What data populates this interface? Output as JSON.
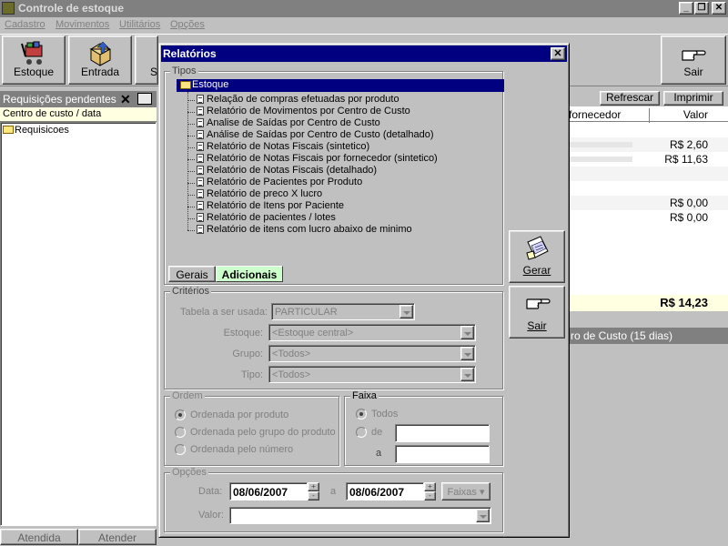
{
  "window": {
    "title": "Controle de estoque"
  },
  "menu": [
    "Cadastro",
    "Movimentos",
    "Utilitários",
    "Opções"
  ],
  "toolbar": {
    "estoque": "Estoque",
    "entrada": "Entrada",
    "saida_partial": "S",
    "sair": "Sair"
  },
  "left_panel": {
    "header": "Requisições pendentes",
    "column": "Centro de custo / data",
    "root": "Requisicoes",
    "tabs": [
      "Atendida",
      "Atender"
    ]
  },
  "right_panel": {
    "buttons": [
      "Refrescar",
      "Imprimir"
    ],
    "columns": [
      "fornecedor",
      "Valor"
    ],
    "rows": [
      {
        "value": "R$ 2,60"
      },
      {
        "value": "R$ 11,63"
      },
      {
        "value": "R$ 0,00"
      },
      {
        "value": "R$ 0,00"
      }
    ],
    "total": "R$  14,23",
    "footer": "ro de Custo (15 dias)"
  },
  "dialog": {
    "title": "Relatórios",
    "tipos": {
      "label": "Tipos",
      "root": "Estoque",
      "items": [
        "Relação de compras efetuadas por produto",
        "Relatório de Movimentos por Centro de Custo",
        "Analise de Saídas por Centro de Custo",
        "Análise de Saídas por Centro de Custo (detalhado)",
        "Relatório de Notas Fiscais (sintetico)",
        "Relatório de Notas Fiscais por fornecedor (sintetico)",
        "Relatório de Notas Fiscais (detalhado)",
        "Relatório de Pacientes por Produto",
        "Relatório de preco X lucro",
        "Relatório de Itens por Paciente",
        "Relatório de pacientes / lotes",
        "Relatório de itens com lucro abaixo de minimo"
      ],
      "tabs": [
        "Gerais",
        "Adicionais"
      ]
    },
    "gerar": "Gerar",
    "sair": "Sair",
    "criterios": {
      "label": "Critérios",
      "tabela_label": "Tabela  a ser usada:",
      "tabela_value": "PARTICULAR",
      "estoque_label": "Estoque:",
      "estoque_value": "<Estoque central>",
      "grupo_label": "Grupo:",
      "grupo_value": "<Todos>",
      "tipo_label": "Tipo:",
      "tipo_value": "<Todos>"
    },
    "ordem": {
      "label": "Ordem",
      "options": [
        "Ordenada por produto",
        "Ordenada pelo grupo do produto",
        "Ordenada pelo número"
      ]
    },
    "faixa": {
      "label": "Faixa",
      "todos": "Todos",
      "de": "de",
      "a": "a"
    },
    "opcoes": {
      "label": "Opções",
      "data_label": "Data:",
      "date_from": "08/06/2007",
      "a_label": "a",
      "date_to": "08/06/2007",
      "faixas": "Faixas",
      "valor_label": "Valor:"
    }
  }
}
